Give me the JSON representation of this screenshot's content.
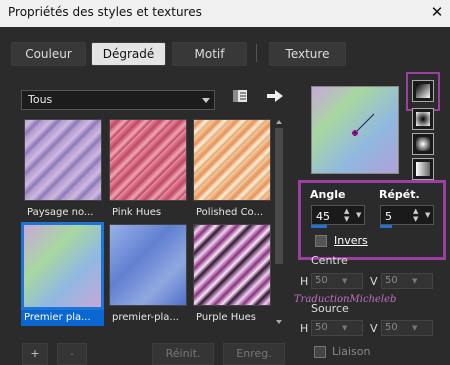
{
  "window": {
    "title": "Propriétés des styles et textures",
    "close": "✕"
  },
  "tabs": [
    "Couleur",
    "Dégradé",
    "Motif",
    "Texture"
  ],
  "library": {
    "category": "Tous"
  },
  "thumbnails": [
    {
      "label": "Paysage no...",
      "selected": false
    },
    {
      "label": "Pink Hues",
      "selected": false
    },
    {
      "label": "Polished Co...",
      "selected": false
    },
    {
      "label": "Premier pla...",
      "selected": true
    },
    {
      "label": "premier-pla...",
      "selected": false
    },
    {
      "label": "Purple Hues",
      "selected": false
    }
  ],
  "bottom_buttons": {
    "add": "+",
    "remove": "-",
    "reset": "Réinit.",
    "save": "Enreg."
  },
  "settings": {
    "angle_label": "Angle",
    "angle_value": "45",
    "repeat_label": "Répét.",
    "repeat_value": "5",
    "invert_label": "Invers",
    "center_label": "Centre",
    "center_h": "50",
    "center_v": "50",
    "source_label": "Source",
    "source_h": "50",
    "source_v": "50",
    "h_label": "H",
    "v_label": "V",
    "link_label": "Liaison"
  },
  "watermark": "TraductionMicheleb",
  "colors": {
    "accent": "#1e74d6",
    "highlight": "#9b3fa0",
    "background": "#2b2b2b"
  }
}
